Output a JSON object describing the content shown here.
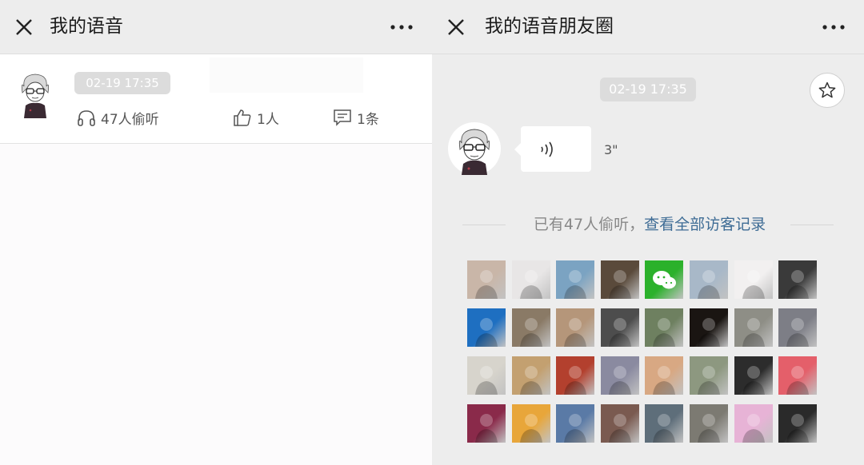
{
  "left": {
    "header": {
      "title": "我的语音"
    },
    "post": {
      "timestamp": "02-19 17:35",
      "listens": "47人偷听",
      "likes": "1人",
      "comments": "1条"
    }
  },
  "right": {
    "header": {
      "title": "我的语音朋友圈"
    },
    "post": {
      "timestamp": "02-19 17:35",
      "duration": "3\""
    },
    "visitors": {
      "count_text": "已有47人偷听，",
      "link_text": "查看全部访客记录"
    },
    "visitor_tiles": [
      {
        "color": "#c9b6a8"
      },
      {
        "color": "#e8e6e6"
      },
      {
        "color": "#7ba3c2"
      },
      {
        "color": "#5a4a3b"
      },
      {
        "color": "#2bb12b"
      },
      {
        "color": "#a8b8c8"
      },
      {
        "color": "#f2f0f0"
      },
      {
        "color": "#3a3a3a"
      },
      {
        "color": "#1e6fc1"
      },
      {
        "color": "#8a7a66"
      },
      {
        "color": "#b5967a"
      },
      {
        "color": "#4d4d4d"
      },
      {
        "color": "#6e8060"
      },
      {
        "color": "#1a1512"
      },
      {
        "color": "#8e8e86"
      },
      {
        "color": "#7d7e86"
      },
      {
        "color": "#d7d4cc"
      },
      {
        "color": "#c3a070"
      },
      {
        "color": "#b3402e"
      },
      {
        "color": "#8a8aa0"
      },
      {
        "color": "#d8a883"
      },
      {
        "color": "#8d9880"
      },
      {
        "color": "#2c2c2c"
      },
      {
        "color": "#e45f6a"
      },
      {
        "color": "#8a2a4a"
      },
      {
        "color": "#e8a63a"
      },
      {
        "color": "#5a7aa6"
      },
      {
        "color": "#7a5a50"
      },
      {
        "color": "#5e6e7a"
      },
      {
        "color": "#7c7a72"
      },
      {
        "color": "#e7b3d6"
      },
      {
        "color": "#2a2a2a"
      }
    ]
  },
  "colors": {
    "link": "#3e6c95",
    "pill": "#dcdcdc",
    "header_bg": "#ededed"
  }
}
